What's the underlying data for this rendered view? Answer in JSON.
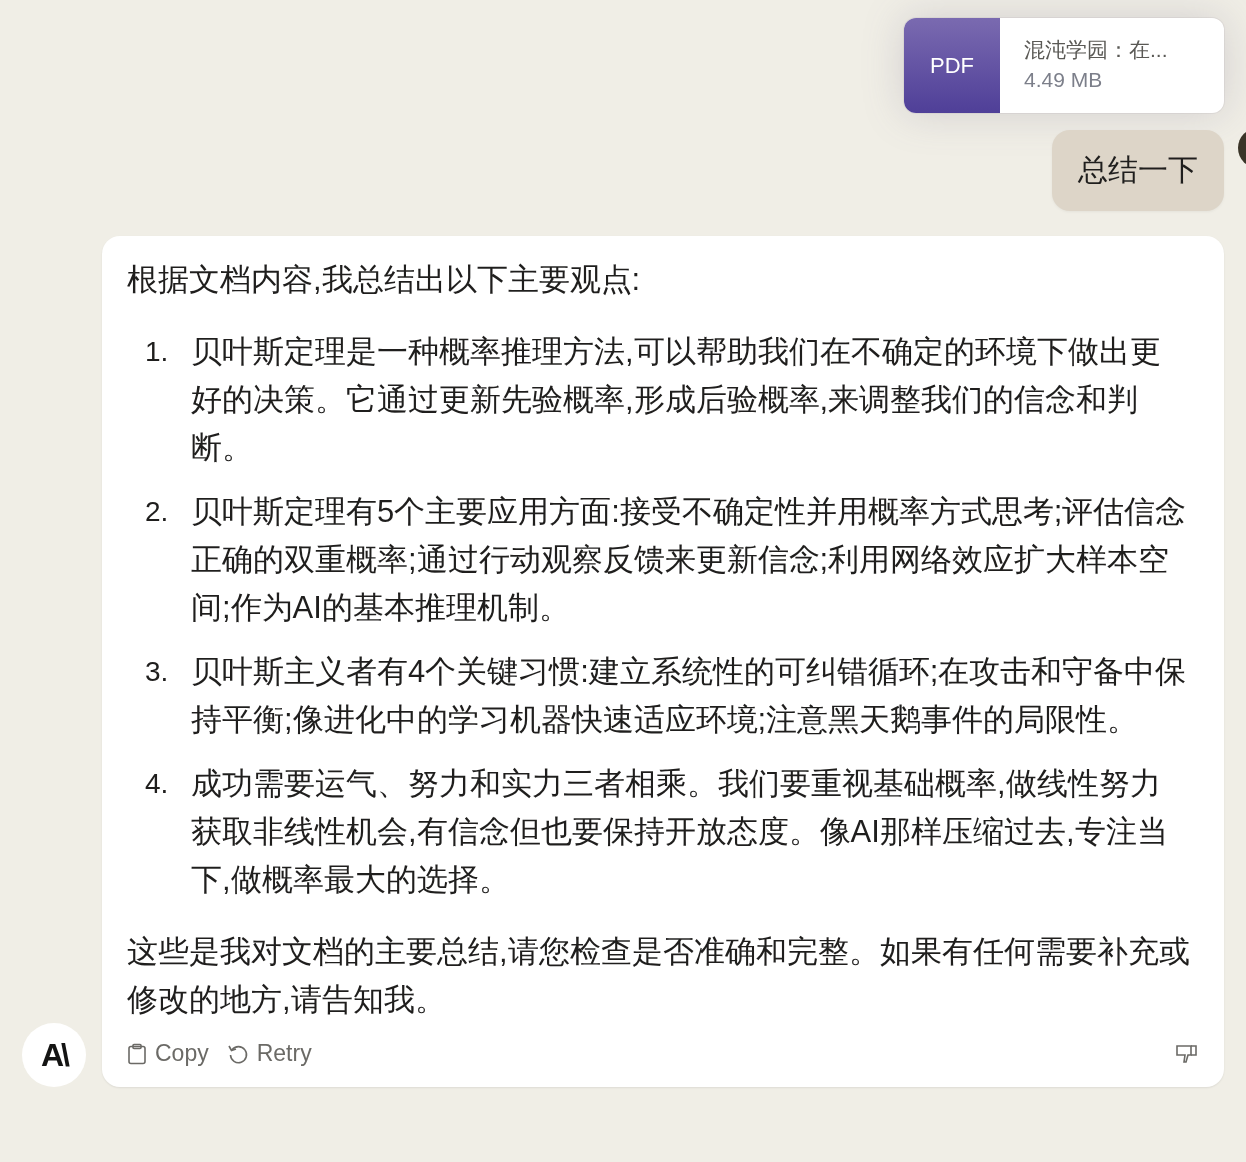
{
  "attachment": {
    "type_label": "PDF",
    "file_name": "混沌学园：在...",
    "file_size": "4.49 MB"
  },
  "user_message": {
    "text": "总结一下"
  },
  "assistant_message": {
    "intro": "根据文档内容,我总结出以下主要观点:",
    "points": [
      {
        "number": "1.",
        "text": "贝叶斯定理是一种概率推理方法,可以帮助我们在不确定的环境下做出更好的决策。它通过更新先验概率,形成后验概率,来调整我们的信念和判断。"
      },
      {
        "number": "2.",
        "text": "贝叶斯定理有5个主要应用方面:接受不确定性并用概率方式思考;评估信念正确的双重概率;通过行动观察反馈来更新信念;利用网络效应扩大样本空间;作为AI的基本推理机制。"
      },
      {
        "number": "3.",
        "text": "贝叶斯主义者有4个关键习惯:建立系统性的可纠错循环;在攻击和守备中保持平衡;像进化中的学习机器快速适应环境;注意黑天鹅事件的局限性。"
      },
      {
        "number": "4.",
        "text": "成功需要运气、努力和实力三者相乘。我们要重视基础概率,做线性努力获取非线性机会,有信念但也要保持开放态度。像AI那样压缩过去,专注当下,做概率最大的选择。"
      }
    ],
    "closing": "这些是我对文档的主要总结,请您检查是否准确和完整。如果有任何需要补充或修改的地方,请告知我。",
    "actions": [
      {
        "kind": "copy",
        "label": "Copy"
      },
      {
        "kind": "retry",
        "label": "Retry"
      }
    ]
  },
  "logo": "A\\"
}
